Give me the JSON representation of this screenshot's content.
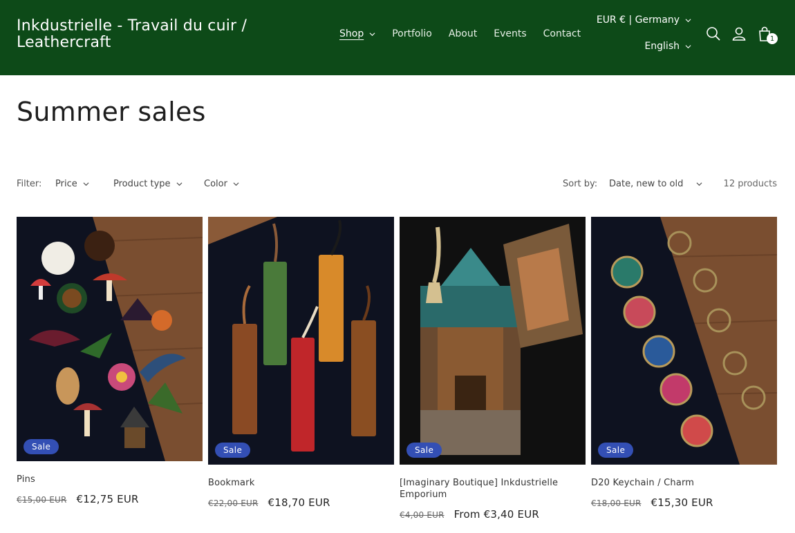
{
  "header": {
    "brand": "Inkdustrielle - Travail du cuir / Leathercraft",
    "nav": [
      "Shop",
      "Portfolio",
      "About",
      "Events",
      "Contact"
    ],
    "currency": "EUR € | Germany",
    "language": "English",
    "cart_count": "1",
    "icons": [
      "search-icon",
      "account-icon",
      "cart-icon"
    ]
  },
  "page": {
    "title": "Summer sales"
  },
  "filters": {
    "label": "Filter:",
    "items": [
      "Price",
      "Product type",
      "Color"
    ],
    "sort_label": "Sort by:",
    "sort_value": "Date, new to old",
    "count": "12 products"
  },
  "products": [
    {
      "title": "Pins",
      "badge": "Sale",
      "old_price": "€15,00 EUR",
      "price": "€12,75 EUR"
    },
    {
      "title": "Bookmark",
      "badge": "Sale",
      "old_price": "€22,00 EUR",
      "price": "€18,70 EUR"
    },
    {
      "title": "[Imaginary Boutique] Inkdustrielle Emporium",
      "badge": "Sale",
      "old_price": "€4,00 EUR",
      "price": "From €3,40 EUR"
    },
    {
      "title": "D20 Keychain / Charm",
      "badge": "Sale",
      "old_price": "€18,00 EUR",
      "price": "€15,30 EUR"
    }
  ],
  "colors": {
    "header_bg": "#0d4a18",
    "sale_badge": "#334fb4"
  }
}
